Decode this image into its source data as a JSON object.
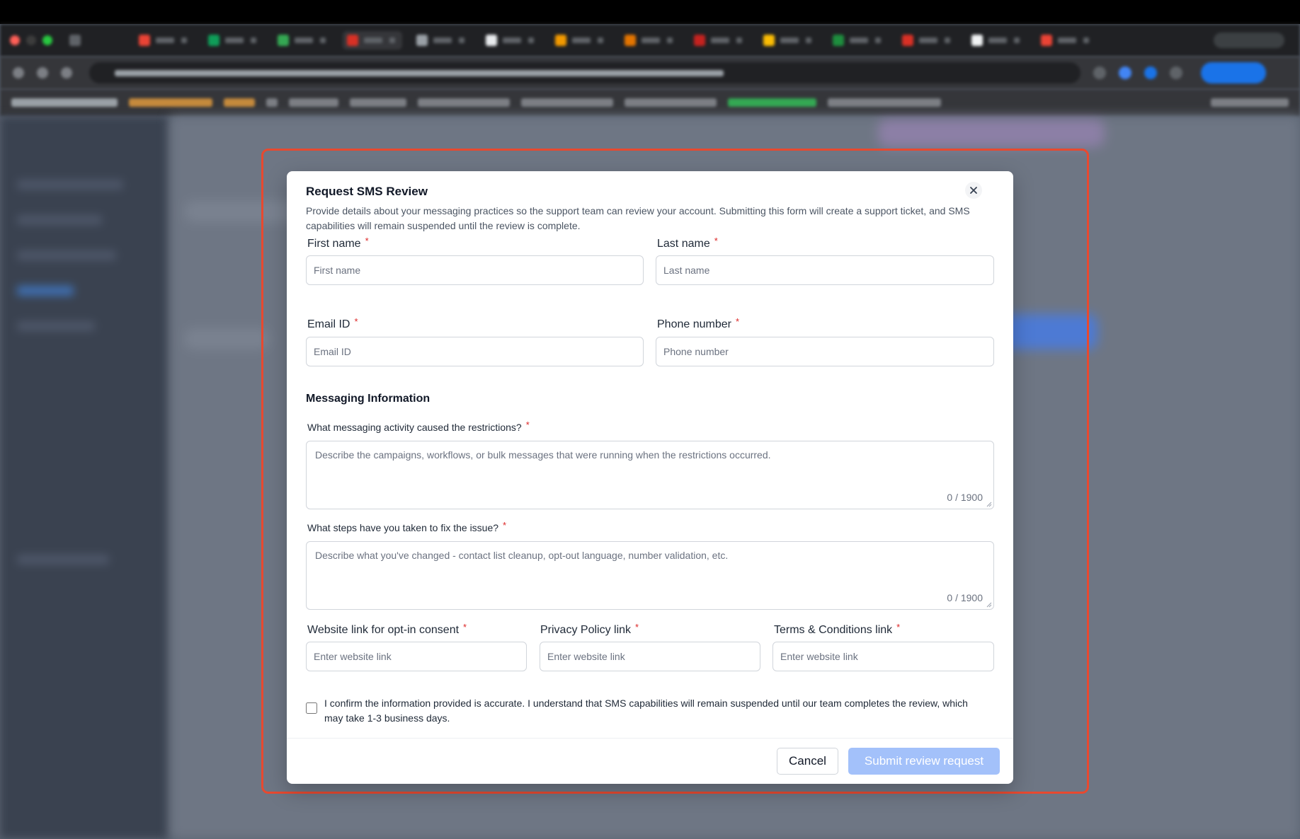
{
  "modal": {
    "title": "Request SMS Review",
    "description": "Provide details about your messaging practices so the support team can review your account. Submitting this form will create a support ticket, and SMS capabilities will remain suspended until the review is complete.",
    "close_icon": "close-icon",
    "required_marker": "*"
  },
  "contact": {
    "first_name": {
      "label": "First name",
      "placeholder": "First name",
      "value": ""
    },
    "last_name": {
      "label": "Last name",
      "placeholder": "Last name",
      "value": ""
    },
    "email": {
      "label": "Email ID",
      "placeholder": "Email ID",
      "value": ""
    },
    "phone": {
      "label": "Phone number",
      "placeholder": "Phone number",
      "value": ""
    }
  },
  "messaging": {
    "section_title": "Messaging Information",
    "activity": {
      "label": "What messaging activity caused the restrictions?",
      "placeholder": "Describe the campaigns, workflows, or bulk messages that were running when the restrictions occurred.",
      "value": "",
      "counter": "0 / 1900"
    },
    "steps": {
      "label": "What steps have you taken to fix the issue?",
      "placeholder": "Describe what you've changed - contact list cleanup, opt-out language, number validation, etc.",
      "value": "",
      "counter": "0 / 1900"
    }
  },
  "links": {
    "optin": {
      "label": "Website link for opt-in consent",
      "placeholder": "Enter website link",
      "value": ""
    },
    "privacy": {
      "label": "Privacy Policy link",
      "placeholder": "Enter website link",
      "value": ""
    },
    "terms": {
      "label": "Terms & Conditions link",
      "placeholder": "Enter website link",
      "value": ""
    }
  },
  "confirm": {
    "text": "I confirm the information provided is accurate. I understand that SMS capabilities will remain suspended until our team completes the review, which may take 1-3 business days.",
    "checked": false
  },
  "footer": {
    "cancel_label": "Cancel",
    "submit_label": "Submit review request"
  },
  "colors": {
    "required": "#dc2626",
    "submit_disabled": "#a3c1fa",
    "highlight_frame": "#e8492f"
  }
}
